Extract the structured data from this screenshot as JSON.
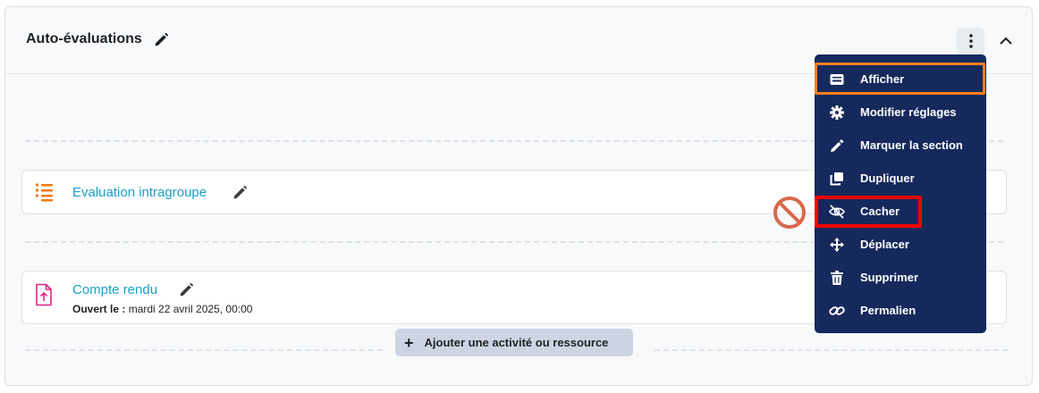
{
  "section": {
    "title": "Auto-évaluations"
  },
  "activities": [
    {
      "name": "Evaluation intragroupe",
      "icon": "feedback-list-icon"
    },
    {
      "name": "Compte rendu",
      "icon": "assignment-upload-icon",
      "meta_label": "Ouvert le :",
      "meta_value": " mardi 22 avril 2025, 00:00"
    }
  ],
  "add_button": {
    "label": "Ajouter une activité ou ressource"
  },
  "menu": {
    "items": [
      {
        "label": "Afficher",
        "icon": "show-icon"
      },
      {
        "label": "Modifier réglages",
        "icon": "gear-icon"
      },
      {
        "label": "Marquer la section",
        "icon": "highlight-pen-icon"
      },
      {
        "label": "Dupliquer",
        "icon": "duplicate-icon"
      },
      {
        "label": "Cacher",
        "icon": "eye-slash-icon"
      },
      {
        "label": "Déplacer",
        "icon": "move-arrows-icon"
      },
      {
        "label": "Supprimer",
        "icon": "trash-icon"
      },
      {
        "label": "Permalien",
        "icon": "link-icon"
      }
    ]
  },
  "colors": {
    "menu_bg": "#16295c",
    "highlight_orange": "#ff7f1e",
    "highlight_red": "#f00000",
    "link": "#1a9fc9",
    "no_sign": "#d9694c"
  }
}
